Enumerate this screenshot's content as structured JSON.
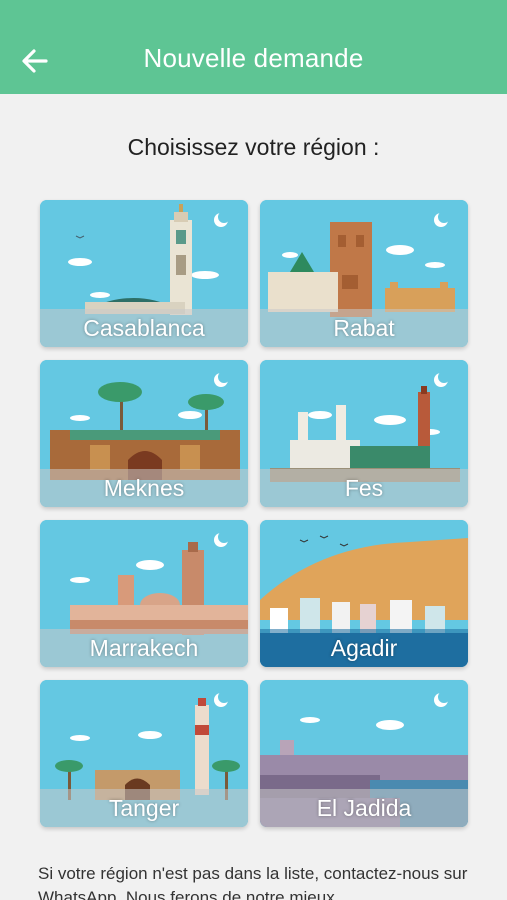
{
  "header": {
    "title": "Nouvelle demande",
    "back_icon": "arrow-left-icon",
    "background": "#5ec594"
  },
  "main": {
    "subtitle": "Choisissez votre région :",
    "regions": [
      {
        "label": "Casablanca"
      },
      {
        "label": "Rabat"
      },
      {
        "label": "Meknes"
      },
      {
        "label": "Fes"
      },
      {
        "label": "Marrakech"
      },
      {
        "label": "Agadir"
      },
      {
        "label": "Tanger"
      },
      {
        "label": "El Jadida"
      }
    ],
    "footer_text": "Si votre région n'est pas dans la liste, contactez-nous sur WhatsApp. Nous ferons de notre mieux"
  }
}
